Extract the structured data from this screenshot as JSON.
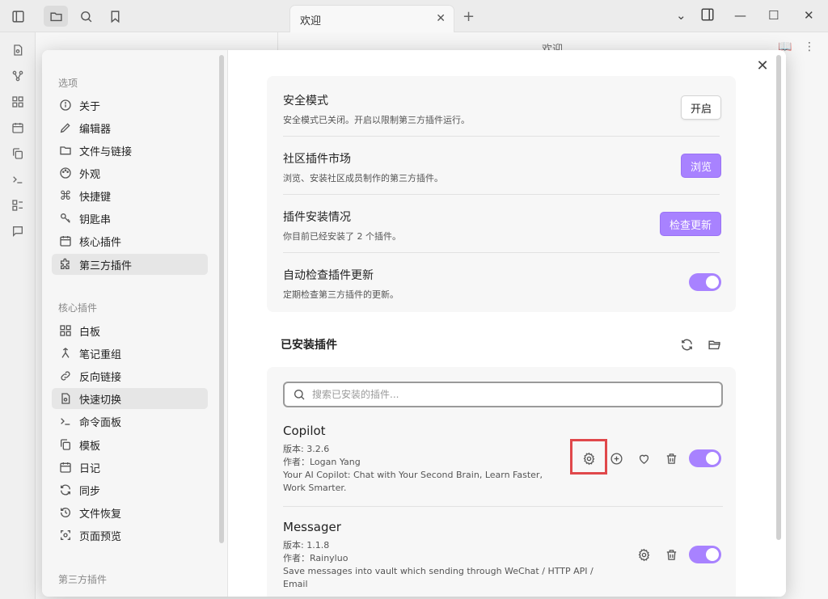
{
  "window": {
    "tab_title": "欢迎",
    "tab_close": "✕",
    "new_tab": "+",
    "note_title": "欢迎",
    "minimize": "—",
    "maximize": "☐",
    "close": "✕"
  },
  "modal": {
    "close": "✕"
  },
  "sidebar": {
    "options_heading": "选项",
    "options": [
      {
        "label": "关于",
        "icon": "info-icon"
      },
      {
        "label": "编辑器",
        "icon": "pencil-icon"
      },
      {
        "label": "文件与链接",
        "icon": "folder-link-icon"
      },
      {
        "label": "外观",
        "icon": "palette-icon"
      },
      {
        "label": "快捷键",
        "icon": "command-icon"
      },
      {
        "label": "钥匙串",
        "icon": "key-icon"
      },
      {
        "label": "核心插件",
        "icon": "calendar-icon"
      },
      {
        "label": "第三方插件",
        "icon": "puzzle-icon"
      }
    ],
    "core_heading": "核心插件",
    "core": [
      {
        "label": "白板",
        "icon": "canvas-icon"
      },
      {
        "label": "笔记重组",
        "icon": "merge-icon"
      },
      {
        "label": "反向链接",
        "icon": "link-icon"
      },
      {
        "label": "快速切换",
        "icon": "quick-switch-icon"
      },
      {
        "label": "命令面板",
        "icon": "terminal-icon"
      },
      {
        "label": "模板",
        "icon": "copy-icon"
      },
      {
        "label": "日记",
        "icon": "calendar-icon"
      },
      {
        "label": "同步",
        "icon": "sync-icon"
      },
      {
        "label": "文件恢复",
        "icon": "history-icon"
      },
      {
        "label": "页面预览",
        "icon": "preview-icon"
      }
    ],
    "third_heading": "第三方插件"
  },
  "settings": {
    "safe_mode": {
      "title": "安全模式",
      "desc": "安全模式已关闭。开启以限制第三方插件运行。",
      "button": "开启"
    },
    "market": {
      "title": "社区插件市场",
      "desc": "浏览、安装社区成员制作的第三方插件。",
      "button": "浏览"
    },
    "installed_info": {
      "title": "插件安装情况",
      "desc": "你目前已经安装了 2 个插件。",
      "button": "检查更新"
    },
    "auto_update": {
      "title": "自动检查插件更新",
      "desc": "定期检查第三方插件的更新。",
      "enabled": true
    }
  },
  "installed": {
    "title": "已安装插件",
    "search_placeholder": "搜索已安装的插件..."
  },
  "plugins": [
    {
      "name": "Copilot",
      "version": "版本: 3.2.6",
      "author": "作者：Logan Yang",
      "desc1": "Your AI Copilot: Chat with Your Second Brain, Learn Faster,",
      "desc2": "Work Smarter.",
      "enabled": true
    },
    {
      "name": "Messager",
      "version": "版本: 1.1.8",
      "author": "作者：Rainyluo",
      "desc1": "Save messages into vault which sending through WeChat / HTTP API /",
      "desc2": "Email",
      "enabled": true
    }
  ],
  "colors": {
    "accent": "#a882ff",
    "highlight": "#e0484b"
  }
}
